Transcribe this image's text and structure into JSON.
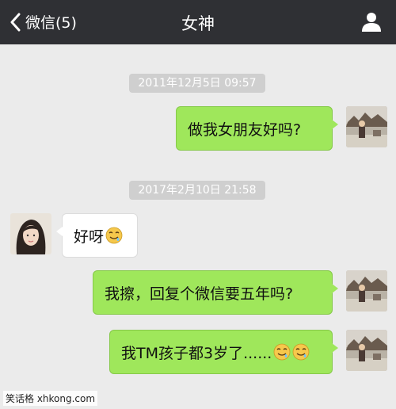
{
  "header": {
    "back_label": "微信(5)",
    "title": "女神"
  },
  "messages": [
    {
      "type": "time",
      "text": "2011年12月5日 09:57"
    },
    {
      "type": "message",
      "from": "me",
      "text": "做我女朋友好吗?"
    },
    {
      "type": "time",
      "text": "2017年2月10日 21:58"
    },
    {
      "type": "message",
      "from": "her",
      "text": "好呀",
      "emoji": "drooling-face"
    },
    {
      "type": "message",
      "from": "me",
      "text": "我擦，回复个微信要五年吗?"
    },
    {
      "type": "message",
      "from": "me",
      "text": "我TM孩子都3岁了......",
      "emoji": "drooling-face x2"
    }
  ],
  "watermark": "笑话格 xhkong.com",
  "colors": {
    "header_bg": "#2f3034",
    "chat_bg": "#ebebeb",
    "my_bubble": "#9fe75b",
    "her_bubble": "#ffffff",
    "time_badge": "#cfcfcf"
  },
  "icons": [
    "chevron-left-icon",
    "profile-icon",
    "drooling-face-emoji"
  ]
}
